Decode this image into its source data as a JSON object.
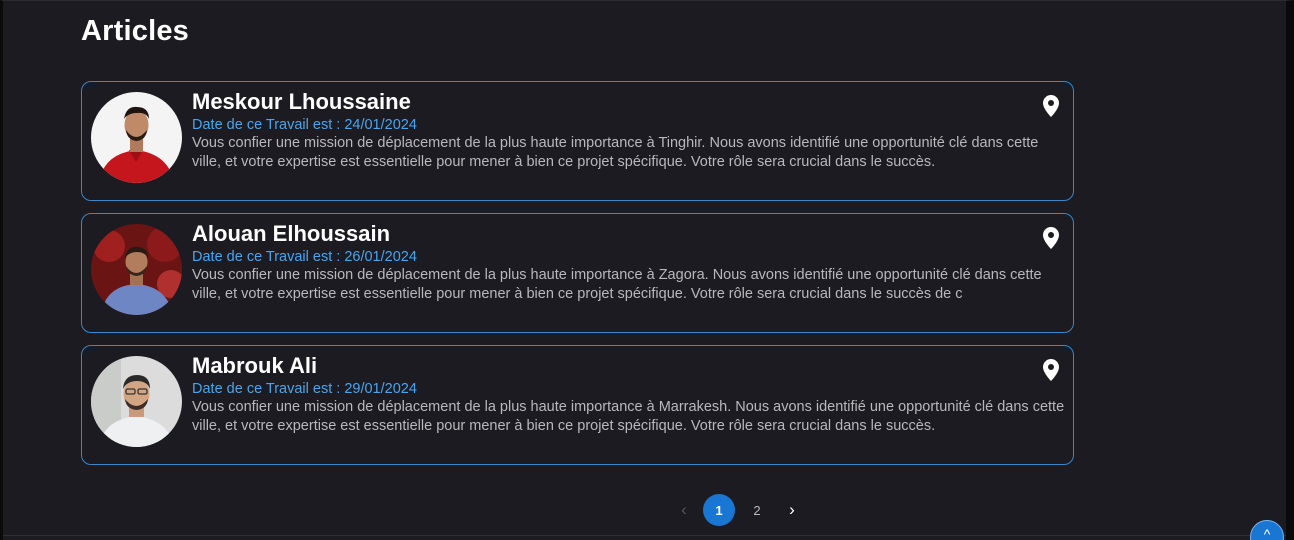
{
  "page": {
    "title": "Articles"
  },
  "articles": [
    {
      "author": "Meskour Lhoussaine",
      "date": "Date de ce Travail est : 24/01/2024",
      "description": "Vous confier une mission de déplacement de la plus haute importance à Tinghir. Nous avons identifié une opportunité clé dans cette ville, et votre expertise est essentielle pour mener à bien ce projet spécifique. Votre rôle sera crucial dans le succès.",
      "location_icon": "map-pin-icon"
    },
    {
      "author": "Alouan Elhoussain",
      "date": "Date de ce Travail est : 26/01/2024",
      "description": "Vous confier une mission de déplacement de la plus haute importance à Zagora. Nous avons identifié une opportunité clé dans cette ville, et votre expertise est essentielle pour mener à bien ce projet spécifique. Votre rôle sera crucial dans le succès de c",
      "location_icon": "map-pin-icon"
    },
    {
      "author": "Mabrouk Ali",
      "date": "Date de ce Travail est : 29/01/2024",
      "description": "Vous confier une mission de déplacement de la plus haute importance à Marrakesh. Nous avons identifié une opportunité clé dans cette ville, et votre expertise est essentielle pour mener à bien ce projet spécifique. Votre rôle sera crucial dans le succès.",
      "location_icon": "map-pin-icon"
    }
  ],
  "pagination": {
    "prev_icon": "‹",
    "pages": [
      "1",
      "2"
    ],
    "current_page": "1",
    "next_icon": "›"
  },
  "scroll_top": {
    "icon": "^"
  },
  "colors": {
    "background": "#1c1b21",
    "card_border": "#3a86c8",
    "date_text": "#4aa5ef",
    "accent": "#1976d2"
  }
}
